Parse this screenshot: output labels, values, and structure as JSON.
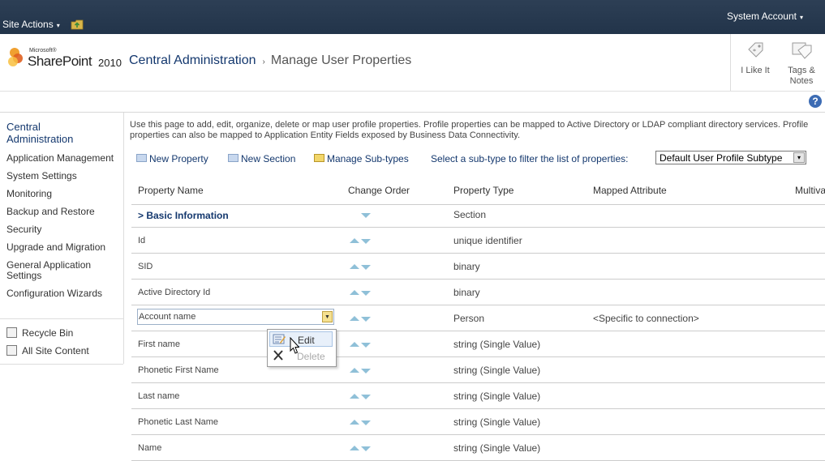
{
  "topbar": {
    "site_actions": "Site Actions",
    "caret": "▾",
    "user": "System Account"
  },
  "logo": {
    "microsoft": "Microsoft®",
    "sharepoint": "SharePoint",
    "year": "2010"
  },
  "breadcrumb": {
    "parent": "Central Administration",
    "separator": "›",
    "current": "Manage User Properties"
  },
  "social": {
    "like": "I Like It",
    "tags_line1": "Tags &",
    "tags_line2": "Notes"
  },
  "help": {
    "symbol": "?"
  },
  "leftnav": {
    "heading_line1": "Central",
    "heading_line2": "Administration",
    "items": [
      "Application Management",
      "System Settings",
      "Monitoring",
      "Backup and Restore",
      "Security",
      "Upgrade and Migration",
      "General Application Settings",
      "Configuration Wizards"
    ],
    "bottom": [
      "Recycle Bin",
      "All Site Content"
    ]
  },
  "intro_text": "Use this page to add, edit, organize, delete or map user profile properties. Profile properties can be mapped to Active Directory or LDAP compliant directory services. Profile properties can also be mapped to Application Entity Fields exposed by Business Data Connectivity.",
  "toolbar": {
    "new_property": "New Property",
    "new_section": "New Section",
    "manage_subtypes": "Manage Sub-types",
    "filter_label": "Select a sub-type to filter the list of properties:",
    "filter_value": "Default User Profile Subtype",
    "filter_arrow": "▾"
  },
  "grid": {
    "columns": [
      "Property Name",
      "Change Order",
      "Property Type",
      "Mapped Attribute",
      "Multiva"
    ],
    "rows": [
      {
        "name": "> Basic Information",
        "type": "Section",
        "mapped": "",
        "bold": true,
        "order": "down"
      },
      {
        "name": "Id",
        "type": "unique identifier",
        "mapped": "",
        "order": "both"
      },
      {
        "name": "SID",
        "type": "binary",
        "mapped": "",
        "order": "both"
      },
      {
        "name": "Active Directory Id",
        "type": "binary",
        "mapped": "",
        "order": "both"
      },
      {
        "name": "Account name",
        "type": "Person",
        "mapped": "<Specific to connection>",
        "order": "both",
        "selected": true
      },
      {
        "name": "First name",
        "type": "string (Single Value)",
        "mapped": "",
        "order": "both"
      },
      {
        "name": "Phonetic First Name",
        "type": "string (Single Value)",
        "mapped": "",
        "order": "both"
      },
      {
        "name": "Last name",
        "type": "string (Single Value)",
        "mapped": "",
        "order": "both"
      },
      {
        "name": "Phonetic Last Name",
        "type": "string (Single Value)",
        "mapped": "",
        "order": "both"
      },
      {
        "name": "Name",
        "type": "string (Single Value)",
        "mapped": "",
        "order": "both"
      }
    ]
  },
  "context_menu": {
    "edit": "Edit",
    "delete": "Delete"
  },
  "colors": {
    "topbar": "#22344a",
    "link": "#14386e",
    "arrow": "#8fc0d8"
  }
}
